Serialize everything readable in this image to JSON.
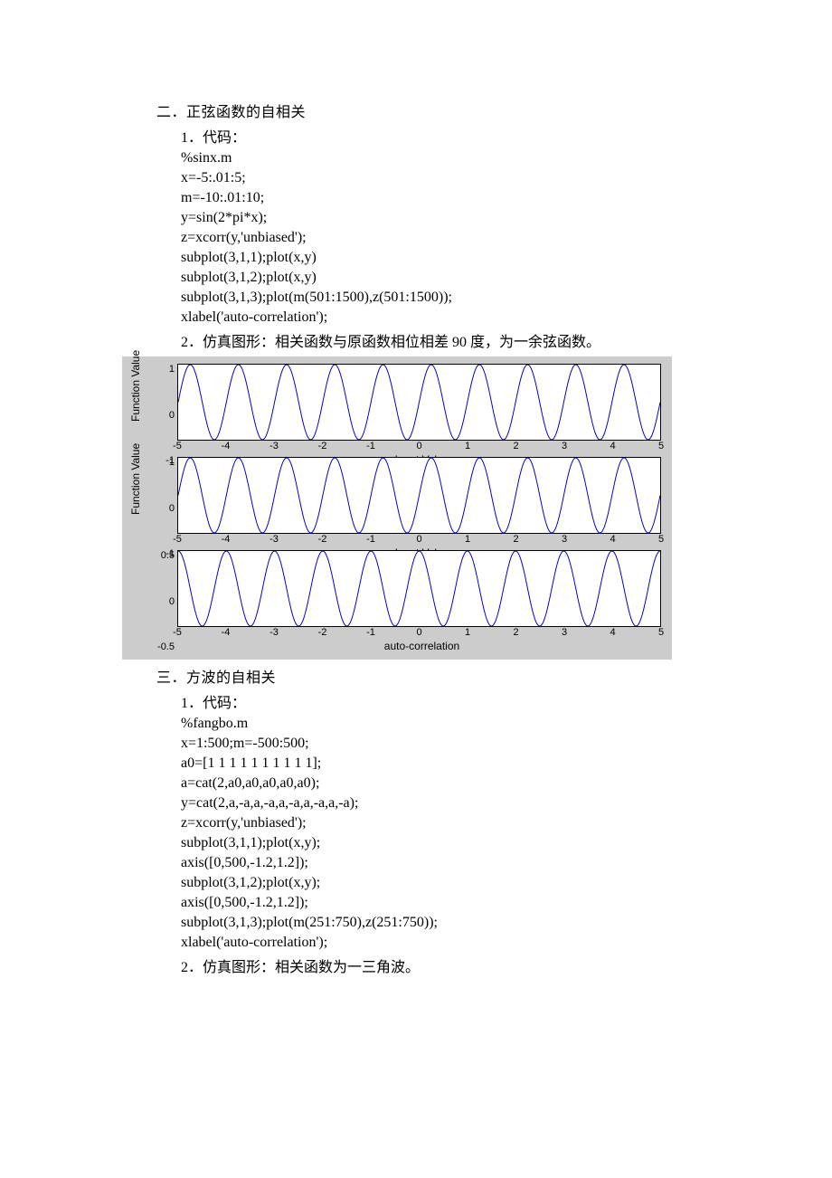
{
  "section2": {
    "heading": "二．正弦函数的自相关",
    "item1_label": "1．代码：",
    "code": [
      "%sinx.m",
      "x=-5:.01:5;",
      "m=-10:.01:10;",
      "y=sin(2*pi*x);",
      "z=xcorr(y,'unbiased');",
      "subplot(3,1,1);plot(x,y)",
      "subplot(3,1,2);plot(x,y)",
      "subplot(3,1,3);plot(m(501:1500),z(501:1500));",
      "xlabel('auto-correlation');"
    ],
    "item2_label": "2．仿真图形：相关函数与原函数相位相差 90 度，为一余弦函数。"
  },
  "section3": {
    "heading": "三．方波的自相关",
    "item1_label": "1．代码：",
    "code": [
      "%fangbo.m",
      "x=1:500;m=-500:500;",
      "a0=[1 1 1 1 1 1 1 1 1 1];",
      "a=cat(2,a0,a0,a0,a0,a0);",
      "y=cat(2,a,-a,a,-a,a,-a,a,-a,a,-a);",
      "z=xcorr(y,'unbiased');",
      "subplot(3,1,1);plot(x,y);",
      "axis([0,500,-1.2,1.2]);",
      "subplot(3,1,2);plot(x,y);",
      "axis([0,500,-1.2,1.2]);",
      "subplot(3,1,3);plot(m(251:750),z(251:750));",
      "xlabel('auto-correlation');"
    ],
    "item2_label": "2．仿真图形：相关函数为一三角波。"
  },
  "chart_data": [
    {
      "type": "line",
      "title": "",
      "xlabel": "Input Value",
      "ylabel": "Function Value",
      "xlim": [
        -5,
        5
      ],
      "ylim": [
        -1,
        1
      ],
      "xticks": [
        -5,
        -4,
        -3,
        -2,
        -1,
        0,
        1,
        2,
        3,
        4,
        5
      ],
      "yticks": [
        1,
        0,
        -1
      ],
      "function": "y = sin(2*pi*x)",
      "frequency_cycles_per_unit": 1,
      "amplitude": 1,
      "phase": "sine"
    },
    {
      "type": "line",
      "title": "",
      "xlabel": "Input Value",
      "ylabel": "Function Value",
      "xlim": [
        -5,
        5
      ],
      "ylim": [
        -1,
        1
      ],
      "xticks": [
        -5,
        -4,
        -3,
        -2,
        -1,
        0,
        1,
        2,
        3,
        4,
        5
      ],
      "yticks": [
        1,
        0,
        -1
      ],
      "function": "y = sin(2*pi*x)",
      "frequency_cycles_per_unit": 1,
      "amplitude": 1,
      "phase": "sine"
    },
    {
      "type": "line",
      "title": "",
      "xlabel": "auto-correlation",
      "ylabel": "",
      "xlim": [
        -5,
        5
      ],
      "ylim": [
        -0.5,
        0.5
      ],
      "xticks": [
        -5,
        -4,
        -3,
        -2,
        -1,
        0,
        1,
        2,
        3,
        4,
        5
      ],
      "yticks": [
        0.5,
        0,
        -0.5
      ],
      "function": "z = 0.5*cos(2*pi*m)",
      "frequency_cycles_per_unit": 1,
      "amplitude": 0.5,
      "phase": "cosine"
    }
  ],
  "labels": {
    "input_value": "Input Value",
    "function_value": "Function Value",
    "auto_correlation": "auto-correlation"
  }
}
